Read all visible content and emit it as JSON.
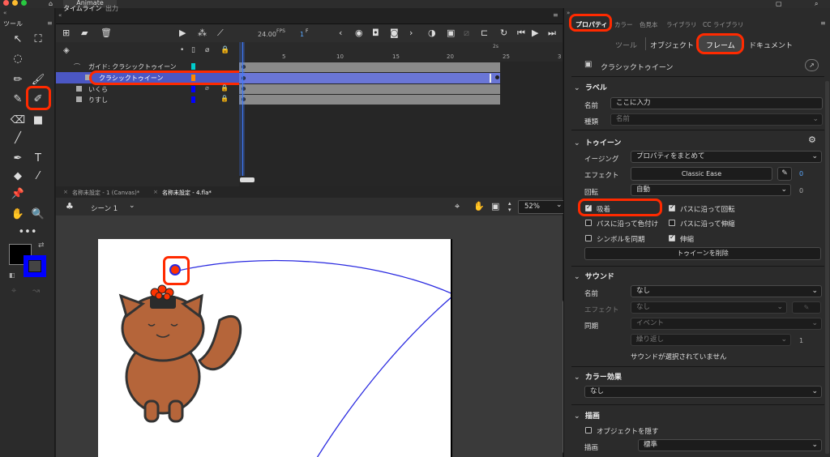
{
  "app": {
    "name": "Animate"
  },
  "toolbar": {
    "title": "ツール"
  },
  "timeline": {
    "tab_timeline": "タイムライン",
    "tab_output": "出力",
    "fps": "24.00",
    "fps_unit": "FPS",
    "frame": "1",
    "frame_unit": "F",
    "ruler_marks": [
      "1s",
      "5",
      "10",
      "15",
      "20",
      "25",
      "2s",
      "3"
    ],
    "layers": [
      {
        "name": "ガイド: クラシックトゥイーン",
        "color": "#00cccc"
      },
      {
        "name": "クラシックトゥイーン",
        "color": "#ff8800"
      },
      {
        "name": "いくら",
        "color": "#0000ff"
      },
      {
        "name": "りすし",
        "color": "#0000ff"
      }
    ]
  },
  "stage": {
    "doc_tab_1": "名称未設定 - 1 (Canvas)*",
    "doc_tab_2": "名称未設定 - 4.fla*",
    "scene": "シーン 1",
    "zoom": "52%"
  },
  "properties": {
    "tab_props": "プロパティ",
    "tab_color": "カラー",
    "tab_swatch": "色見本",
    "tab_library": "ライブラリ",
    "tab_cc": "CC ライブラリ",
    "sub_tool": "ツール",
    "sub_object": "オブジェクト",
    "sub_frame": "フレーム",
    "sub_document": "ドキュメント",
    "object_name": "クラシックトゥイーン",
    "label_section": "ラベル",
    "name_label": "名前",
    "name_placeholder": "ここに入力",
    "kind_label": "種類",
    "kind_value": "名前",
    "tween_section": "トゥイーン",
    "easing_label": "イージング",
    "easing_value": "プロパティをまとめて",
    "effect_label": "エフェクト",
    "effect_value": "Classic Ease",
    "effect_num": "0",
    "rotate_label": "回転",
    "rotate_value": "自動",
    "rotate_num": "0",
    "snap": "吸着",
    "orient_path": "パスに沿って回転",
    "color_along": "パスに沿って色付け",
    "scale_along": "パスに沿って伸縮",
    "sync": "シンボルを同期",
    "scale": "伸縮",
    "delete_tween": "トゥイーンを削除",
    "sound_section": "サウンド",
    "sound_name_label": "名前",
    "sound_name_value": "なし",
    "sound_effect_label": "エフェクト",
    "sound_effect_value": "なし",
    "sync_label": "同期",
    "sync_value": "イベント",
    "repeat_value": "繰り返し",
    "repeat_num": "1",
    "no_sound": "サウンドが選択されていません",
    "color_effect_section": "カラー効果",
    "color_effect_value": "なし",
    "draw_section": "描画",
    "hide_object": "オブジェクトを隠す",
    "draw_label": "描画",
    "draw_value": "標準"
  },
  "colors": {
    "highlight": "#ff2a00",
    "selection": "#4b57c4",
    "path": "#2a2ae0"
  }
}
